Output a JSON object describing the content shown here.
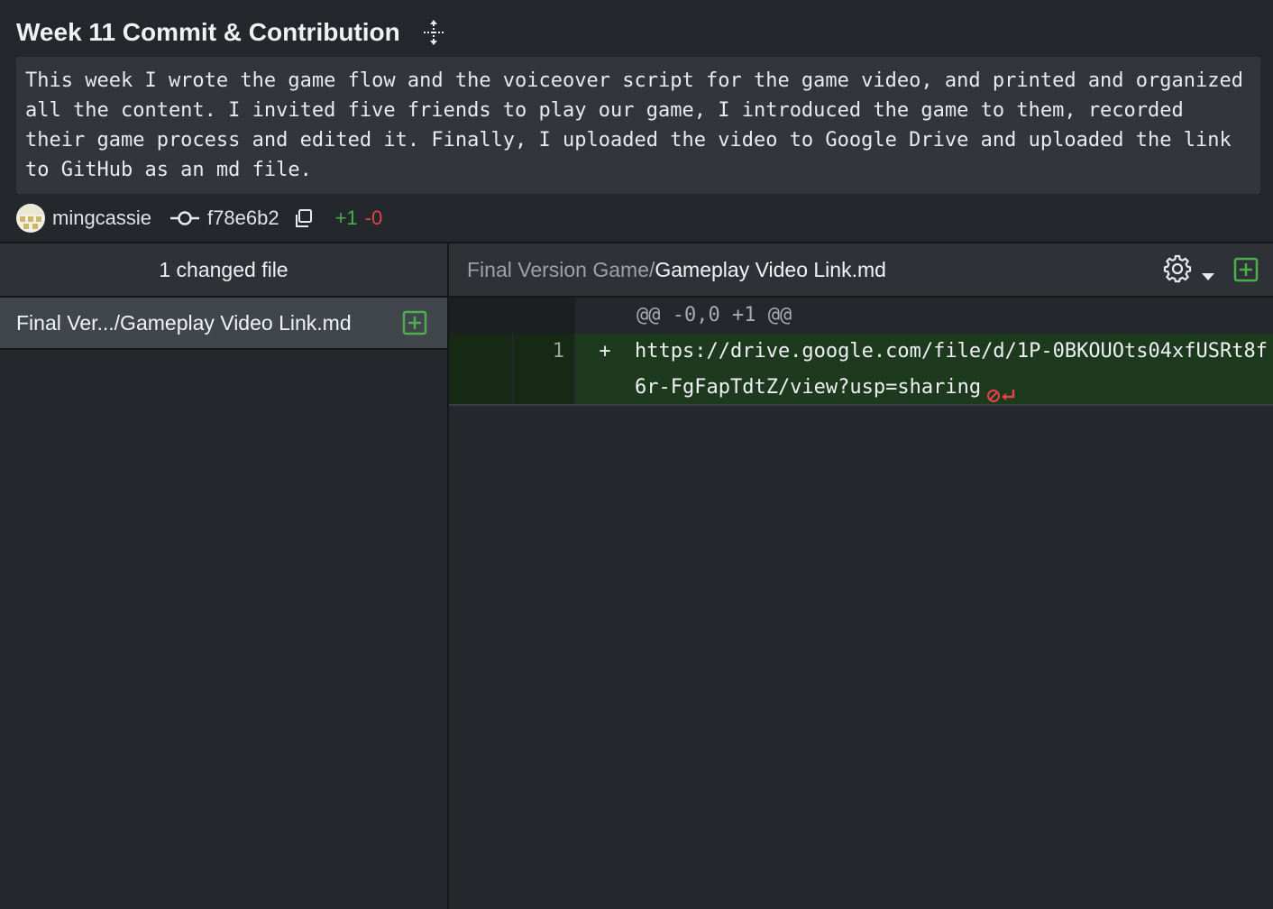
{
  "commit": {
    "title": "Week 11 Commit & Contribution",
    "description": "This week I wrote the game flow and the voiceover script for the game video, and printed and organized all the content. I invited five friends to play our game, I introduced the game to them, recorded their game process and edited it. Finally, I uploaded the video to Google Drive and uploaded the link to GitHub as an md file.",
    "author": "mingcassie",
    "sha": "f78e6b2",
    "additions": "+1",
    "deletions": "-0"
  },
  "sidebar": {
    "header": "1 changed file",
    "files": [
      {
        "label": "Final Ver.../Gameplay Video Link.md",
        "status": "added"
      }
    ]
  },
  "diff": {
    "path_dir": "Final Version Game/",
    "path_file": "Gameplay Video Link.md",
    "hunk": "@@ -0,0 +1 @@",
    "lines": [
      {
        "new_number": "1",
        "sign": "+",
        "text": "https://drive.google.com/file/d/1P-0BKOUOts04xfUSRt8f6r-FgFapTdtZ/view?usp=sharing"
      }
    ]
  },
  "icons": {
    "move": "move-icon",
    "commit": "commit-icon",
    "copy": "copy-icon",
    "gear": "gear-icon",
    "chevron": "chevron-down-icon",
    "added_file": "plus-square-icon",
    "no_newline": "no-newline-icon"
  },
  "colors": {
    "background": "#24272c",
    "added": "#4cae4f",
    "deleted": "#e0434b",
    "added_line_bg": "#1d3a1f"
  }
}
